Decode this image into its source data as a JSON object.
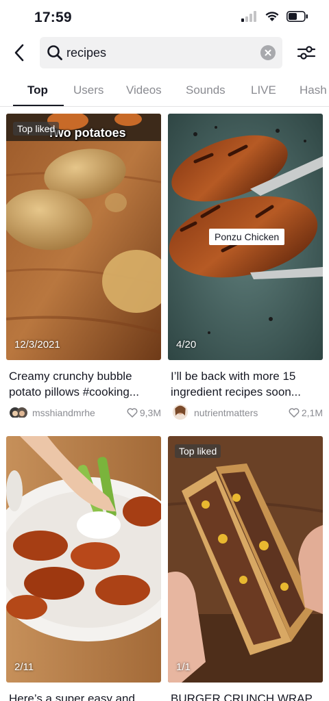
{
  "status": {
    "time": "17:59"
  },
  "search": {
    "query": "recipes"
  },
  "tabs": [
    {
      "label": "Top",
      "active": true
    },
    {
      "label": "Users"
    },
    {
      "label": "Videos"
    },
    {
      "label": "Sounds"
    },
    {
      "label": "LIVE"
    },
    {
      "label": "Hash"
    }
  ],
  "results": [
    {
      "badge": "Top liked",
      "overlay_text": "Two potatoes",
      "date": "12/3/2021",
      "caption_line1": "Creamy crunchy bubble",
      "caption_line2": "potato pillows #cooking...",
      "username": "msshiandmrhe",
      "likes": "9,3M"
    },
    {
      "sticker": "Ponzu Chicken",
      "date": "4/20",
      "caption_line1": "I’ll be back with more 15",
      "caption_line2": "ingredient recipes soon...",
      "username": "nutrientmatters",
      "likes": "2,1M"
    },
    {
      "date": "2/11",
      "caption_line1": "Here’s a super easy and"
    },
    {
      "badge": "Top liked",
      "date": "1/1",
      "caption_line1": "BURGER CRUNCH WRAP"
    }
  ],
  "colors": {
    "text": "#161823",
    "muted": "#8a8b91",
    "search_bg": "#f1f1f2"
  }
}
